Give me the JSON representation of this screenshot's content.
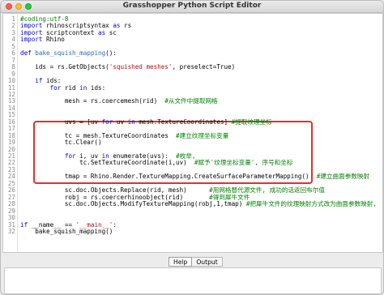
{
  "window": {
    "title": "Grasshopper Python Script Editor"
  },
  "tabs": [
    {
      "label": "Help"
    },
    {
      "label": "Output"
    }
  ],
  "code_lines": [
    {
      "n": "1",
      "tokens": [
        {
          "c": "cm",
          "t": "#coding:utf-8"
        }
      ]
    },
    {
      "n": "2",
      "tokens": [
        {
          "c": "kw",
          "t": "import"
        },
        {
          "c": "",
          "t": " rhinoscriptsyntax "
        },
        {
          "c": "kw",
          "t": "as"
        },
        {
          "c": "",
          "t": " rs"
        }
      ]
    },
    {
      "n": "3",
      "tokens": [
        {
          "c": "kw",
          "t": "import"
        },
        {
          "c": "",
          "t": " scriptcontext "
        },
        {
          "c": "kw",
          "t": "as"
        },
        {
          "c": "",
          "t": " sc"
        }
      ]
    },
    {
      "n": "4",
      "tokens": [
        {
          "c": "kw",
          "t": "import"
        },
        {
          "c": "",
          "t": " Rhino"
        }
      ]
    },
    {
      "n": "5",
      "tokens": []
    },
    {
      "n": "6",
      "tokens": [
        {
          "c": "kw",
          "t": "def"
        },
        {
          "c": "",
          "t": " "
        },
        {
          "c": "fn",
          "t": "bake_squish_mapping"
        },
        {
          "c": "",
          "t": "():"
        }
      ]
    },
    {
      "n": "7",
      "tokens": []
    },
    {
      "n": "8",
      "tokens": [
        {
          "c": "",
          "t": "    ids = rs.GetObjects("
        },
        {
          "c": "str",
          "t": "'squished meshes'"
        },
        {
          "c": "",
          "t": ", preselect=True)"
        }
      ]
    },
    {
      "n": "9",
      "tokens": []
    },
    {
      "n": "10",
      "tokens": [
        {
          "c": "",
          "t": "    "
        },
        {
          "c": "kw",
          "t": "if"
        },
        {
          "c": "",
          "t": " ids:"
        }
      ]
    },
    {
      "n": "11",
      "tokens": [
        {
          "c": "",
          "t": "        "
        },
        {
          "c": "kw",
          "t": "for"
        },
        {
          "c": "",
          "t": " rid "
        },
        {
          "c": "kw",
          "t": "in"
        },
        {
          "c": "",
          "t": " ids:"
        }
      ]
    },
    {
      "n": "12",
      "tokens": []
    },
    {
      "n": "13",
      "tokens": [
        {
          "c": "",
          "t": "            mesh = rs.coercemesh(rid)  "
        },
        {
          "c": "cm",
          "t": "#从文件中提取网格"
        }
      ]
    },
    {
      "n": "14",
      "tokens": []
    },
    {
      "n": "15",
      "tokens": []
    },
    {
      "n": "16",
      "tokens": [
        {
          "c": "",
          "t": "            uvs = [uv "
        },
        {
          "c": "kw",
          "t": "for"
        },
        {
          "c": "",
          "t": " uv "
        },
        {
          "c": "kw",
          "t": "in"
        },
        {
          "c": "",
          "t": " mesh.TextureCoordinates] "
        },
        {
          "c": "cm",
          "t": "#提取纹理坐标"
        }
      ]
    },
    {
      "n": "17",
      "tokens": []
    },
    {
      "n": "18",
      "tokens": [
        {
          "c": "",
          "t": "            tc = mesh.TextureCoordinates  "
        },
        {
          "c": "cm",
          "t": "#建立纹理坐标变量"
        }
      ]
    },
    {
      "n": "19",
      "tokens": [
        {
          "c": "",
          "t": "            tc.Clear()"
        }
      ]
    },
    {
      "n": "20",
      "tokens": []
    },
    {
      "n": "21",
      "tokens": [
        {
          "c": "",
          "t": "            "
        },
        {
          "c": "kw",
          "t": "for"
        },
        {
          "c": "",
          "t": " i, uv "
        },
        {
          "c": "kw",
          "t": "in"
        },
        {
          "c": "",
          "t": " enumerate(uvs):  "
        },
        {
          "c": "cm",
          "t": "#枚举,"
        }
      ]
    },
    {
      "n": "22",
      "tokens": [
        {
          "c": "",
          "t": "                tc.SetTextureCoordinate(i,uv)  "
        },
        {
          "c": "cm",
          "t": "#赋予'纹理坐标变量', 序号和坐标"
        }
      ]
    },
    {
      "n": "23",
      "tokens": []
    },
    {
      "n": "24",
      "tokens": [
        {
          "c": "",
          "t": "            tmap = Rhino.Render.TextureMapping.CreateSurfaceParameterMapping()  "
        },
        {
          "c": "cm",
          "t": "#建立曲面参数映射"
        }
      ]
    },
    {
      "n": "25",
      "tokens": []
    },
    {
      "n": "26",
      "tokens": [
        {
          "c": "",
          "t": "            sc.doc.Objects.Replace(rid, mesh)      "
        },
        {
          "c": "cm",
          "t": "#用网格替代源文件, 成功的话返回布尔值"
        }
      ]
    },
    {
      "n": "27",
      "tokens": [
        {
          "c": "",
          "t": "            robj = rs.coercerhinoobject(rid)       "
        },
        {
          "c": "cm",
          "t": "#得到犀牛文件"
        }
      ]
    },
    {
      "n": "28",
      "tokens": [
        {
          "c": "",
          "t": "            sc.doc.Objects.ModifyTextureMapping(robj,1,tmap) "
        },
        {
          "c": "cm",
          "t": "#把犀牛文件的纹理映射方式改为曲面参数映射,"
        }
      ]
    },
    {
      "n": "29",
      "tokens": []
    },
    {
      "n": "30",
      "tokens": []
    },
    {
      "n": "31",
      "tokens": [
        {
          "c": "kw",
          "t": "if"
        },
        {
          "c": "",
          "t": " __name__ == "
        },
        {
          "c": "str",
          "t": "'__main__'"
        },
        {
          "c": "",
          "t": ":"
        }
      ]
    },
    {
      "n": "32",
      "tokens": [
        {
          "c": "",
          "t": "    bake_squish_mapping()"
        }
      ]
    }
  ],
  "colors": {
    "highlight_box": "#e0322b",
    "keyword": "#0000c8",
    "comment": "#008000",
    "string": "#a31515"
  }
}
